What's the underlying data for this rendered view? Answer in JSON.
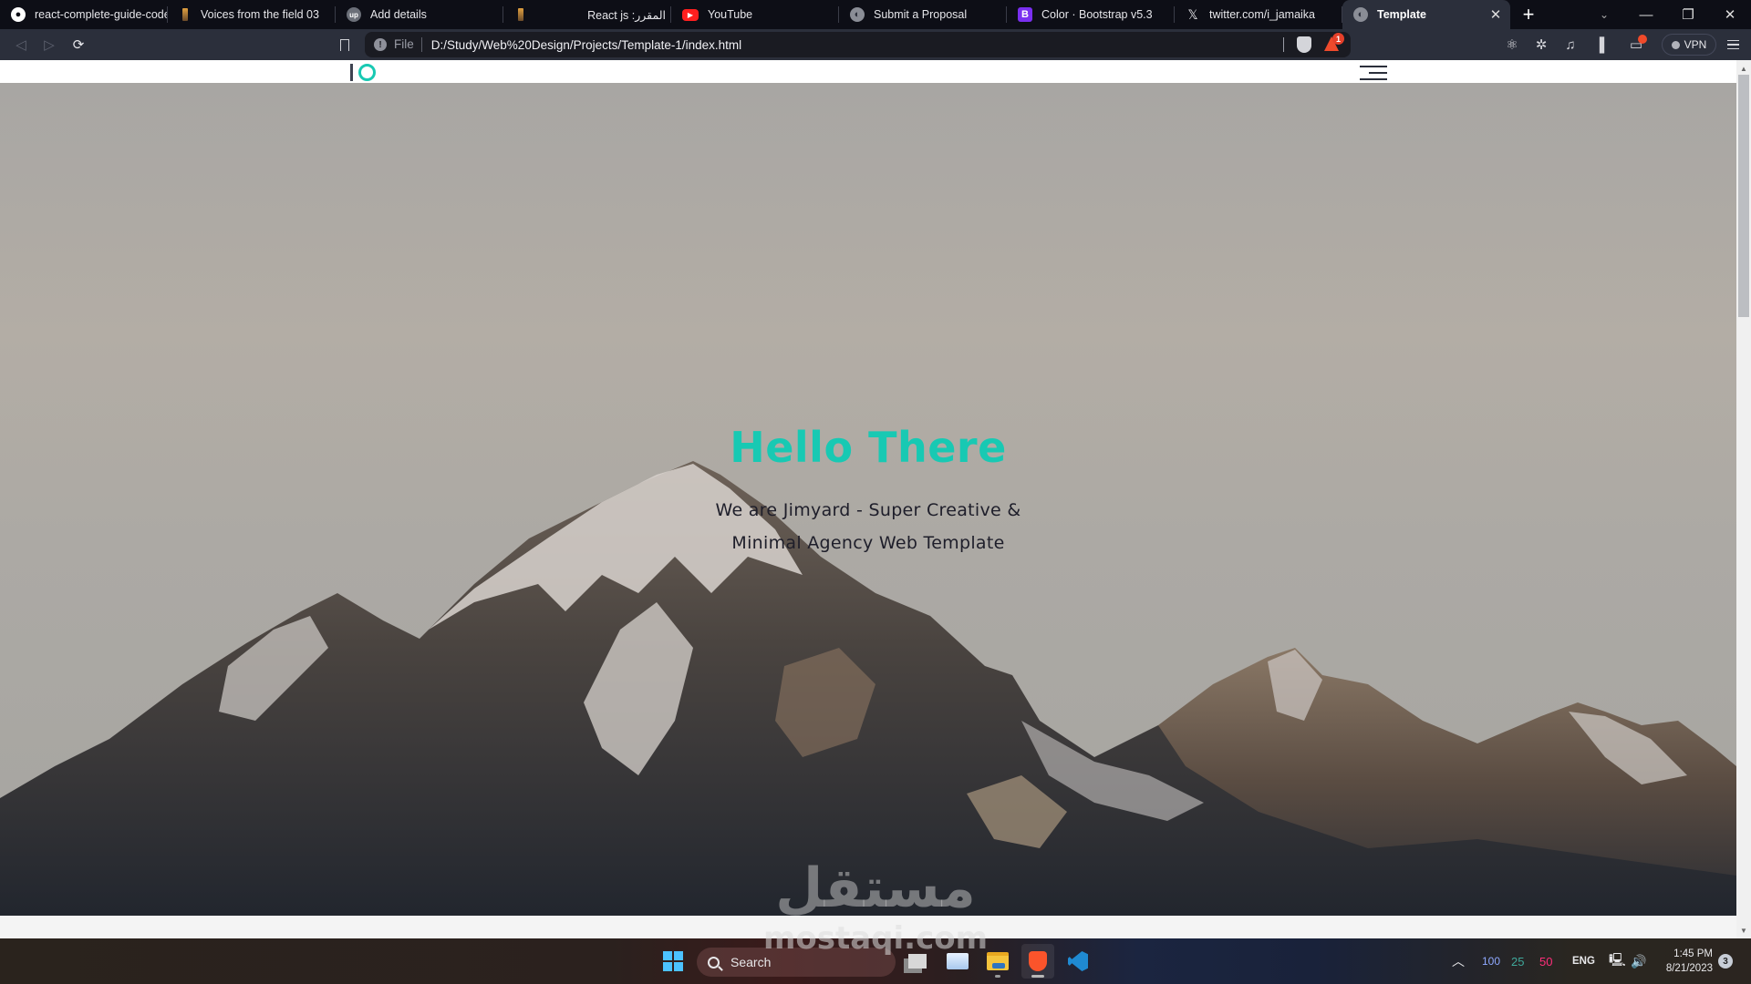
{
  "browser": {
    "tabs": [
      {
        "title": "react-complete-guide-code/",
        "icon": "github-icon",
        "active": false
      },
      {
        "title": "Voices from the field 03",
        "icon": "candle-icon",
        "active": false
      },
      {
        "title": "Add details",
        "icon": "upwork-icon",
        "active": false
      },
      {
        "title": "المقرر: React js",
        "icon": "candle-icon",
        "active": false
      },
      {
        "title": "YouTube",
        "icon": "youtube-icon",
        "active": false
      },
      {
        "title": "Submit a Proposal",
        "icon": "globe-icon",
        "active": false
      },
      {
        "title": "Color · Bootstrap v5.3",
        "icon": "bootstrap-icon",
        "active": false
      },
      {
        "title": "twitter.com/i_jamaika",
        "icon": "x-icon",
        "active": false
      },
      {
        "title": "Template",
        "icon": "globe-icon",
        "active": true
      }
    ],
    "new_tab": "+",
    "tab_search": "⌄",
    "window_controls": {
      "minimize": "—",
      "maximize": "❐",
      "close": "✕"
    },
    "address": {
      "scheme_label": "File",
      "url": "D:/Study/Web%20Design/Projects/Template-1/index.html"
    },
    "rewards_badge": "1",
    "vpn_label": "VPN"
  },
  "page": {
    "logo": {
      "accent": "#18c9b3"
    },
    "hero": {
      "title": "Hello There",
      "subtitle": "We are Jimyard - Super Creative & Minimal Agency Web Template",
      "title_color": "#18c9b3"
    },
    "scroll": {
      "position_fraction": 0.0
    }
  },
  "taskbar": {
    "search_placeholder": "Search",
    "apps": [
      "task-view",
      "resource-monitor",
      "file-explorer",
      "brave-browser",
      "vs-code"
    ],
    "tray": {
      "cpu": "100",
      "val25": "25",
      "val50": "50",
      "language": "ENG",
      "time": "1:45 PM",
      "date": "8/21/2023",
      "notifications": "3"
    }
  },
  "watermark": {
    "arabic": "مستقل",
    "latin": "mostaqi.com"
  }
}
